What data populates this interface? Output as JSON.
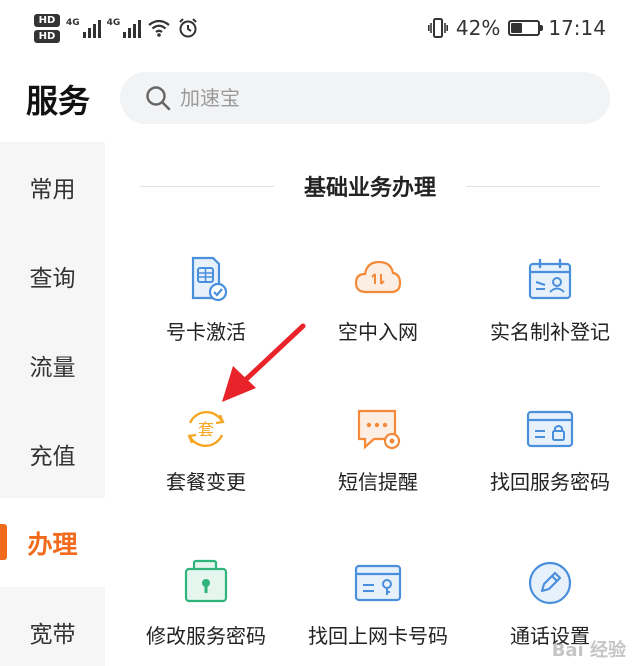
{
  "status_bar": {
    "hd_1": "HD",
    "hd_2": "HD",
    "net_1": "4G",
    "net_2": "4G",
    "battery_pct": "42%",
    "battery_level": 0.42,
    "time": "17:14"
  },
  "header": {
    "title": "服务",
    "search_placeholder": "加速宝"
  },
  "sidebar": {
    "items": [
      {
        "label": "常用"
      },
      {
        "label": "查询"
      },
      {
        "label": "流量"
      },
      {
        "label": "充值"
      },
      {
        "label": "办理",
        "active": true
      },
      {
        "label": "宽带"
      }
    ]
  },
  "section": {
    "title": "基础业务办理",
    "services": [
      {
        "label": "号卡激活",
        "icon": "sim-card-check-icon"
      },
      {
        "label": "空中入网",
        "icon": "cloud-transfer-icon"
      },
      {
        "label": "实名制补登记",
        "icon": "id-card-calendar-icon"
      },
      {
        "label": "套餐变更",
        "icon": "package-change-icon"
      },
      {
        "label": "短信提醒",
        "icon": "sms-settings-icon"
      },
      {
        "label": "找回服务密码",
        "icon": "card-lock-icon"
      },
      {
        "label": "修改服务密码",
        "icon": "lock-box-icon"
      },
      {
        "label": "找回上网卡号码",
        "icon": "card-key-icon"
      },
      {
        "label": "通话设置",
        "icon": "pen-circle-icon"
      }
    ]
  },
  "icon_colors": {
    "blue": "#4a8fdc",
    "orange": "#f28a3a",
    "green": "#2fb47c",
    "accent": "#f26a1b",
    "arrow": "#e8232a"
  },
  "watermark": "Bai 经验"
}
